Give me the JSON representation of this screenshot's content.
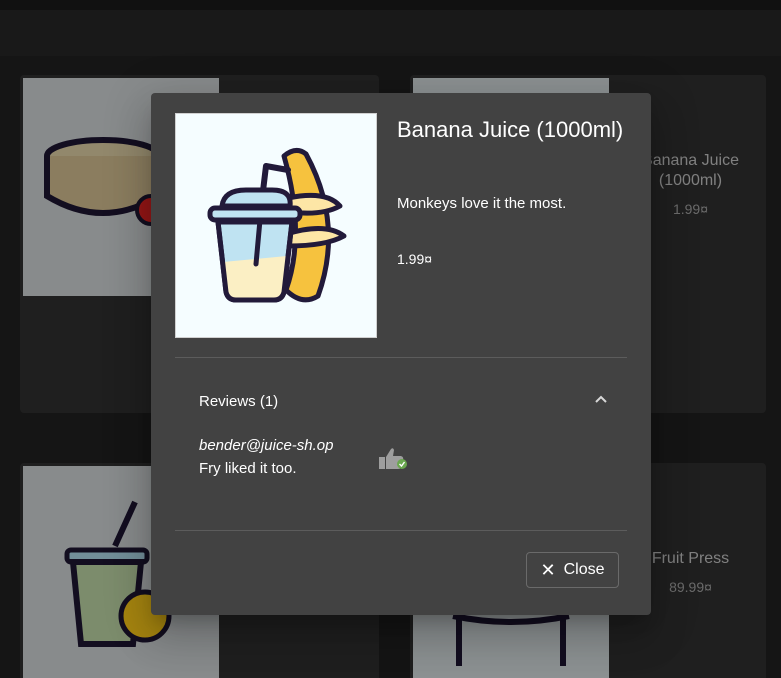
{
  "background_cards": [
    {
      "title": "Banana Juice\n(1000ml)",
      "price": "1.99¤"
    },
    {
      "title": "Fruit Press",
      "price": "89.99¤"
    }
  ],
  "dialog": {
    "title": "Banana Juice (1000ml)",
    "description": "Monkeys love it the most.",
    "price": "1.99¤",
    "reviews": {
      "header": "Reviews (1)",
      "items": [
        {
          "author": "bender@juice-sh.op",
          "text": "Fry liked it too."
        }
      ]
    },
    "close_label": "Close",
    "icons": {
      "collapse": "chevron-up-icon",
      "like": "thumbs-up-icon",
      "close": "close-icon"
    }
  },
  "colors": {
    "dialog_bg": "#424242",
    "page_bg": "#1f1f1f",
    "card_bg": "#2e2e2e",
    "accent_green": "#6aa84f"
  }
}
